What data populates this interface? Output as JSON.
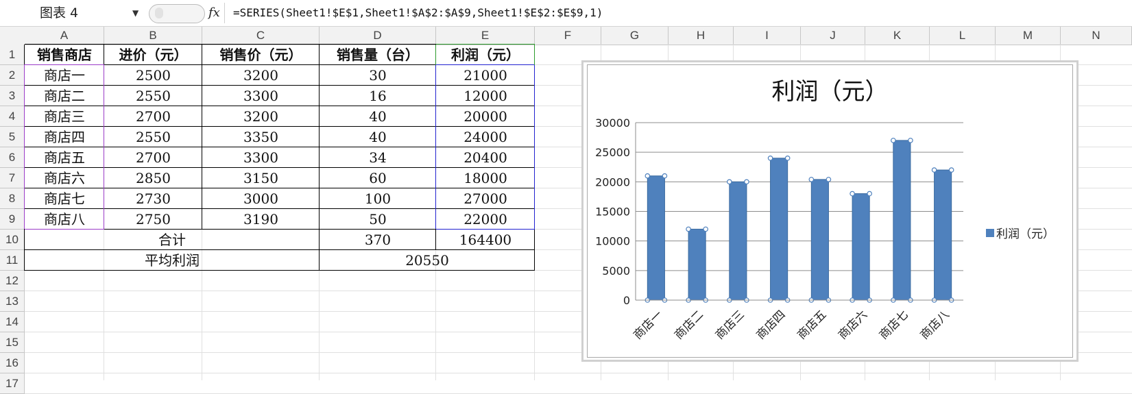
{
  "formula_bar": {
    "name_box": "图表 4",
    "fx_label": "fx",
    "formula": "=SERIES(Sheet1!$E$1,Sheet1!$A$2:$A$9,Sheet1!$E$2:$E$9,1)"
  },
  "columns": [
    "A",
    "B",
    "C",
    "D",
    "E",
    "F",
    "G",
    "H",
    "I",
    "J",
    "K",
    "L",
    "M",
    "N"
  ],
  "rows": [
    "1",
    "2",
    "3",
    "4",
    "5",
    "6",
    "7",
    "8",
    "9",
    "10",
    "11",
    "12",
    "13",
    "14",
    "15",
    "16",
    "17"
  ],
  "table": {
    "headers": [
      "销售商店",
      "进价（元）",
      "销售价（元）",
      "销售量（台）",
      "利润（元）"
    ],
    "rows": [
      [
        "商店一",
        "2500",
        "3200",
        "30",
        "21000"
      ],
      [
        "商店二",
        "2550",
        "3300",
        "16",
        "12000"
      ],
      [
        "商店三",
        "2700",
        "3200",
        "40",
        "20000"
      ],
      [
        "商店四",
        "2550",
        "3350",
        "40",
        "24000"
      ],
      [
        "商店五",
        "2700",
        "3300",
        "34",
        "20400"
      ],
      [
        "商店六",
        "2850",
        "3150",
        "60",
        "18000"
      ],
      [
        "商店七",
        "2730",
        "3000",
        "100",
        "27000"
      ],
      [
        "商店八",
        "2750",
        "3190",
        "50",
        "22000"
      ]
    ],
    "total_label": "合计",
    "total_sales": "370",
    "total_profit": "164400",
    "avg_label": "平均利润",
    "avg_profit": "20550"
  },
  "colors": {
    "bar": "#4f81bd",
    "selection_purple": "#9b3bc8",
    "selection_blue": "#2020d0",
    "selection_green": "#2a9a2a"
  },
  "chart_data": {
    "type": "bar",
    "title": "利润（元）",
    "categories": [
      "商店一",
      "商店二",
      "商店三",
      "商店四",
      "商店五",
      "商店六",
      "商店七",
      "商店八"
    ],
    "series": [
      {
        "name": "利润（元）",
        "values": [
          21000,
          12000,
          20000,
          24000,
          20400,
          18000,
          27000,
          22000
        ]
      }
    ],
    "ylim": [
      0,
      30000
    ],
    "yticks": [
      "0",
      "5000",
      "10000",
      "15000",
      "20000",
      "25000",
      "30000"
    ],
    "grid": true,
    "legend": "right"
  }
}
